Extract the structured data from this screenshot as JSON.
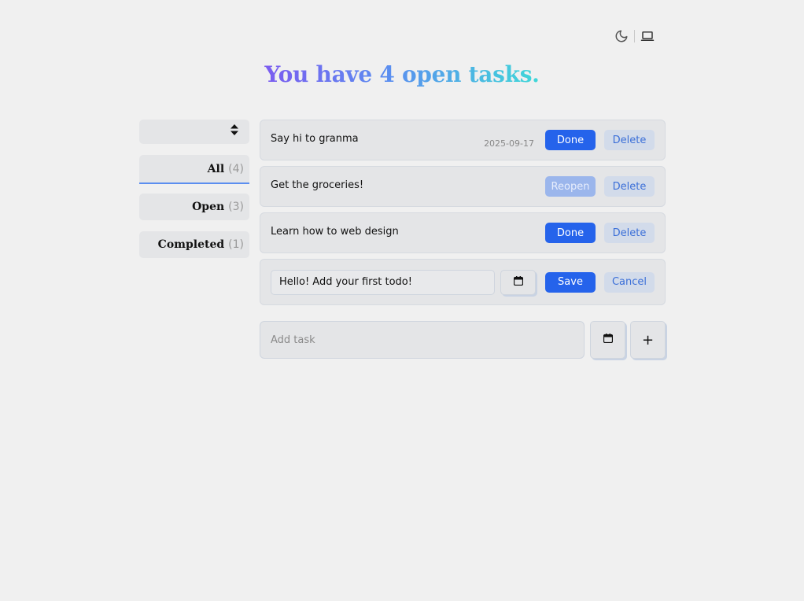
{
  "theme_toggle": {
    "dark_icon": "moon-icon",
    "system_icon": "laptop-icon"
  },
  "heading": {
    "text": "You have 4 open tasks."
  },
  "sidebar": {
    "sort_icon": "sort-arrows-icon",
    "filters": [
      {
        "label": "All",
        "count": "(4)",
        "active": true
      },
      {
        "label": "Open",
        "count": "(3)",
        "active": false
      },
      {
        "label": "Completed",
        "count": "(1)",
        "active": false
      }
    ]
  },
  "tasks": [
    {
      "title": "Say hi to granma",
      "date": "2025-09-17",
      "primary": "Done",
      "secondary": "Delete",
      "completed": false
    },
    {
      "title": "Get the groceries!",
      "date": "",
      "primary": "Reopen",
      "secondary": "Delete",
      "completed": true
    },
    {
      "title": "Learn how to web design",
      "date": "",
      "primary": "Done",
      "secondary": "Delete",
      "completed": false
    }
  ],
  "editing": {
    "value": "Hello! Add your first todo!",
    "calendar_icon": "calendar-icon",
    "save_label": "Save",
    "cancel_label": "Cancel"
  },
  "add": {
    "placeholder": "Add task",
    "calendar_icon": "calendar-icon",
    "plus_label": "+"
  },
  "colors": {
    "accent": "#2563eb",
    "gradient_start": "#7b5cf0",
    "gradient_end": "#3fd8d8",
    "background": "#f0f0f0"
  }
}
